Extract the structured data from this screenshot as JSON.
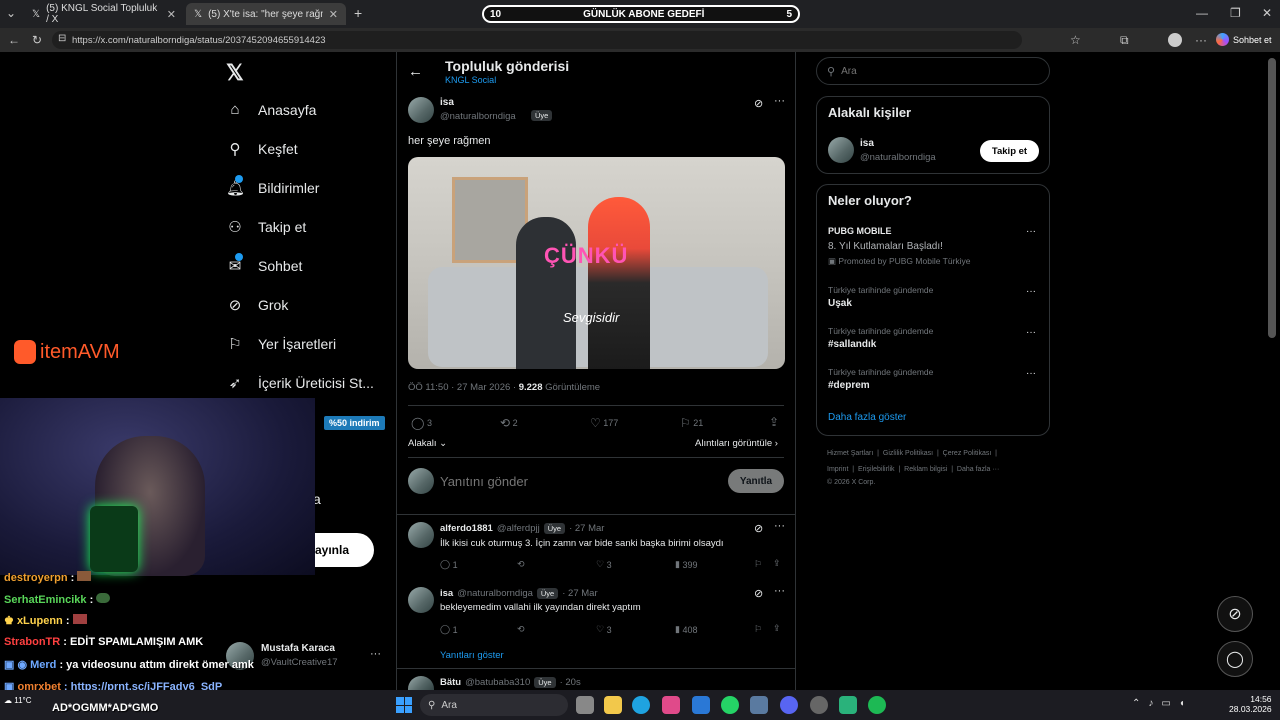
{
  "browser": {
    "tabs": [
      {
        "title": "(5) KNGL Social Topluluk / X"
      },
      {
        "title": "(5) X'te isa: \"her şeye rağmen\""
      }
    ],
    "url": "https://x.com/naturalborndiga/status/2037452094655914423",
    "chat_btn": "Sohbet et"
  },
  "overlay_banner": {
    "left": "10",
    "title": "GÜNLÜK ABONE GEDEFİ",
    "right": "5"
  },
  "sidebar": {
    "items": [
      {
        "label": "Anasayfa",
        "icon": "home-icon"
      },
      {
        "label": "Keşfet",
        "icon": "search-icon"
      },
      {
        "label": "Bildirimler",
        "icon": "bell-icon"
      },
      {
        "label": "Takip et",
        "icon": "follow-icon"
      },
      {
        "label": "Sohbet",
        "icon": "mail-icon"
      },
      {
        "label": "Grok",
        "icon": "grok-icon"
      },
      {
        "label": "Yer İşaretleri",
        "icon": "bookmark-icon"
      },
      {
        "label": "İçerik Üreticisi St...",
        "icon": "rocket-icon"
      }
    ],
    "post_btn_partial": "ayınla",
    "more_partial": "a",
    "profile": {
      "name": "Mustafa Karaca",
      "handle": "@VaultCreative17"
    }
  },
  "header": {
    "title": "Topluluk gönderisi",
    "subtitle": "KNGL Social"
  },
  "post": {
    "name": "isa",
    "handle": "@naturalborndiga",
    "badge": "Üye",
    "text": "her şeye rağmen",
    "image_text": "ÇÜNKÜ",
    "image_caption": "Sevgisidir",
    "time": "ÖÖ 11:50 · 27 Mar 2026 · ",
    "views": "9.228",
    "views_label": " Görüntüleme",
    "replies": "3",
    "reposts": "2",
    "likes": "177",
    "bookmarks": "21",
    "sort": "Alakalı",
    "quotes": "Alıntıları görüntüle"
  },
  "reply_box": {
    "placeholder": "Yanıtını gönder",
    "button": "Yanıtla"
  },
  "replies": [
    {
      "name": "alferdo1881",
      "handle": "@alferdpjj",
      "badge": "Üye",
      "date": "· 27 Mar",
      "text": "İlk ikisi cuk oturmuş 3. İçin zamn var bide sanki başka birimi olsaydı",
      "replies": "1",
      "likes": "3",
      "views": "399"
    },
    {
      "name": "isa",
      "handle": "@naturalborndiga",
      "badge": "Üye",
      "date": "· 27 Mar",
      "text": "bekleyemedim vallahi ilk yayından direkt yaptım",
      "replies": "1",
      "likes": "3",
      "views": "408"
    }
  ],
  "show_replies": "Yanıtları göster",
  "third_reply": {
    "name": "Bätu",
    "handle": "@batubaba310",
    "badge": "Üye",
    "date": "· 20s"
  },
  "right": {
    "search_placeholder": "Ara",
    "related_title": "Alakalı kişiler",
    "related": {
      "name": "isa",
      "handle": "@naturalborndiga",
      "button": "Takip et"
    },
    "trends_title": "Neler oluyor?",
    "trends": [
      {
        "context": "PUBG MOBILE",
        "title": "8. Yıl Kutlamaları Başladı!",
        "promo": "Promoted by PUBG Mobile Türkiye"
      },
      {
        "context": "Türkiye tarihinde gündemde",
        "title": "Uşak"
      },
      {
        "context": "Türkiye tarihinde gündemde",
        "title": "#sallandık"
      },
      {
        "context": "Türkiye tarihinde gündemde",
        "title": "#deprem"
      }
    ],
    "more": "Daha fazla göster",
    "footer1": "Hizmet Şartları  |  Gizlilik Politikası  |  Çerez Politikası  |",
    "footer2": "Imprint  |  Erişilebilirlik  |  Reklam bilgisi  |  Daha fazla ···",
    "footer3": "© 2026 X Corp."
  },
  "stream": {
    "logo": "itemAVM",
    "discount": "%50 indirim",
    "chat": [
      {
        "user": "destroyerpn",
        "msg": " :",
        "color": "#f0a030"
      },
      {
        "user": "SerhatEmincikk",
        "msg": " :",
        "color": "#59d659"
      },
      {
        "user": "xLupenn",
        "msg": " :",
        "color": "#ffd34d"
      },
      {
        "user": "StrabonTR",
        "msg": " : EDİT SPAMLAMIŞIM AMK",
        "color": "#ff4040"
      },
      {
        "user": "Merd",
        "msg": " : ya videosunu attım direkt ömer amk",
        "color": "#6ea8ff"
      },
      {
        "user": "omrxbet",
        "msg": " : https://prnt.sc/jJFFady6_SdP",
        "color": "#f08030"
      },
      {
        "user": "",
        "msg": "AD*OGMM*AD*GMO",
        "color": "#fff"
      }
    ]
  },
  "taskbar": {
    "search": "Ara",
    "weather": "11°C",
    "time": "14:56",
    "date": "28.03.2026"
  }
}
